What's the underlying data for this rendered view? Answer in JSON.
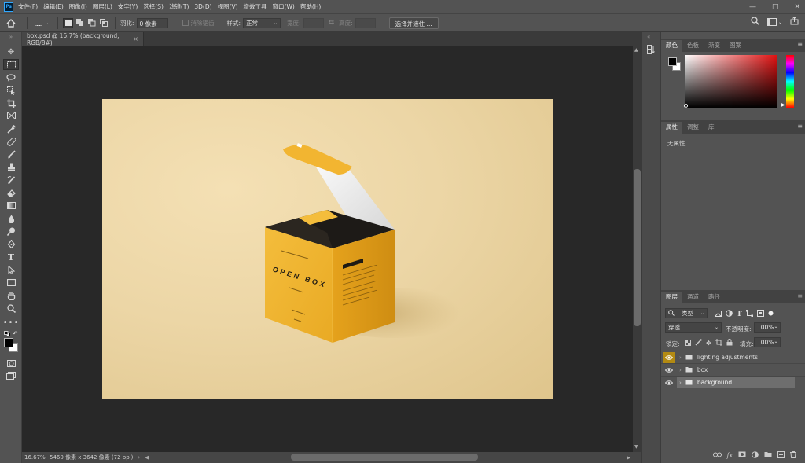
{
  "app": {
    "logo": "Ps",
    "menu": [
      "文件(F)",
      "编辑(E)",
      "图像(I)",
      "图层(L)",
      "文字(Y)",
      "选择(S)",
      "滤镜(T)",
      "3D(D)",
      "视图(V)",
      "增效工具",
      "窗口(W)",
      "帮助(H)"
    ],
    "window_controls": [
      "minimize-icon",
      "maximize-icon",
      "close-icon"
    ]
  },
  "options": {
    "feather_label": "羽化:",
    "feather_value": "0 像素",
    "antialias_label": "消除锯齿",
    "style_label": "样式:",
    "style_value": "正常",
    "width_label": "宽度:",
    "height_label": "高度:",
    "select_mask_button": "选择并遮住 ..."
  },
  "document": {
    "tab_title": "box.psd @ 16.7% (background, RGB/8#)",
    "zoom": "16.67%",
    "size_info": "5460 像素 x 3642 像素 (72 ppi)"
  },
  "artwork": {
    "box_title": "OPEN BOX",
    "box_accent": "#f2b531",
    "background_color": "#ecd6a6"
  },
  "color_panel": {
    "tabs": [
      "颜色",
      "色板",
      "渐变",
      "图案"
    ],
    "foreground": "#000000",
    "background": "#ffffff",
    "hue_color": "#e01010"
  },
  "properties_panel": {
    "tabs": [
      "属性",
      "调整",
      "库"
    ],
    "empty_text": "无属性"
  },
  "layers_panel": {
    "tabs": [
      "图层",
      "通道",
      "路径"
    ],
    "filter_label": "类型",
    "blend_mode": "穿透",
    "opacity_label": "不透明度:",
    "opacity_value": "100%",
    "lock_label": "锁定:",
    "fill_label": "填充:",
    "fill_value": "100%",
    "layers": [
      {
        "name": "lighting adjustments",
        "visible": true,
        "selected": false,
        "eye_highlight": true
      },
      {
        "name": "box",
        "visible": true,
        "selected": false,
        "eye_highlight": false
      },
      {
        "name": "background",
        "visible": true,
        "selected": true,
        "eye_highlight": false
      }
    ]
  }
}
